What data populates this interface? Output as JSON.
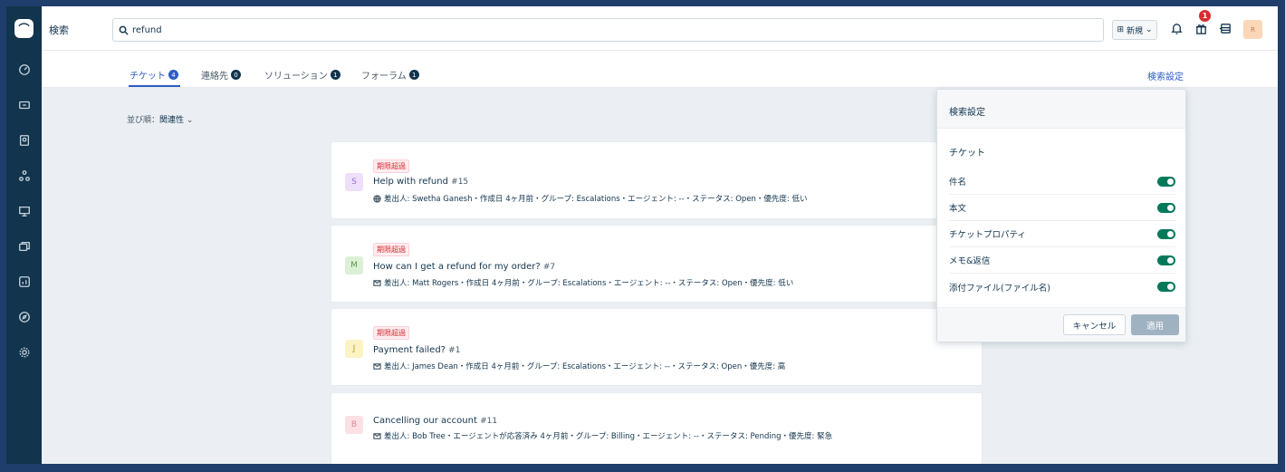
{
  "header": {
    "title": "検索",
    "search_value": "refund",
    "new_label": "新規",
    "notification_count": "1",
    "avatar_text": "R"
  },
  "tabs": [
    {
      "label": "チケット",
      "count": "4"
    },
    {
      "label": "連絡先",
      "count": "0"
    },
    {
      "label": "ソリューション",
      "count": "1"
    },
    {
      "label": "フォーラム",
      "count": "1"
    }
  ],
  "search_settings_link": "検索設定",
  "sort": {
    "label": "並び順：",
    "value": "関連性"
  },
  "tickets": [
    {
      "tag": "期限超過",
      "avatar": "S",
      "subject": "Help with refund",
      "number": "#15",
      "meta": "差出人: Swetha Ganesh・作成日 4ヶ月前・グループ: Escalations・エージェント: --・ステータス: Open・優先度: 低い"
    },
    {
      "tag": "期限超過",
      "avatar": "M",
      "subject": "How can I get a refund for my order?",
      "number": "#7",
      "meta": "差出人: Matt Rogers・作成日 4ヶ月前・グループ: Escalations・エージェント: --・ステータス: Open・優先度: 低い"
    },
    {
      "tag": "期限超過",
      "avatar": "J",
      "subject": "Payment failed?",
      "number": "#1",
      "meta": "差出人: James Dean・作成日 4ヶ月前・グループ: Escalations・エージェント: --・ステータス: Open・優先度: 高"
    },
    {
      "tag": "",
      "avatar": "B",
      "subject": "Cancelling our account",
      "number": "#11",
      "meta": "差出人: Bob Tree・エージェントが応答済み 4ヶ月前・グループ: Billing・エージェント: --・ステータス: Pending・優先度: 緊急"
    }
  ],
  "panel": {
    "title": "検索設定",
    "section": "チケット",
    "options": [
      "件名",
      "本文",
      "チケットプロパティ",
      "メモ&返信",
      "添付ファイル(ファイル名)"
    ],
    "cancel_label": "キャンセル",
    "apply_label": "適用"
  },
  "colors": {
    "accent": "#2c5cc5",
    "toggle_on": "#00795b",
    "nav_bg": "#12344d",
    "overdue": "#d72d30"
  }
}
